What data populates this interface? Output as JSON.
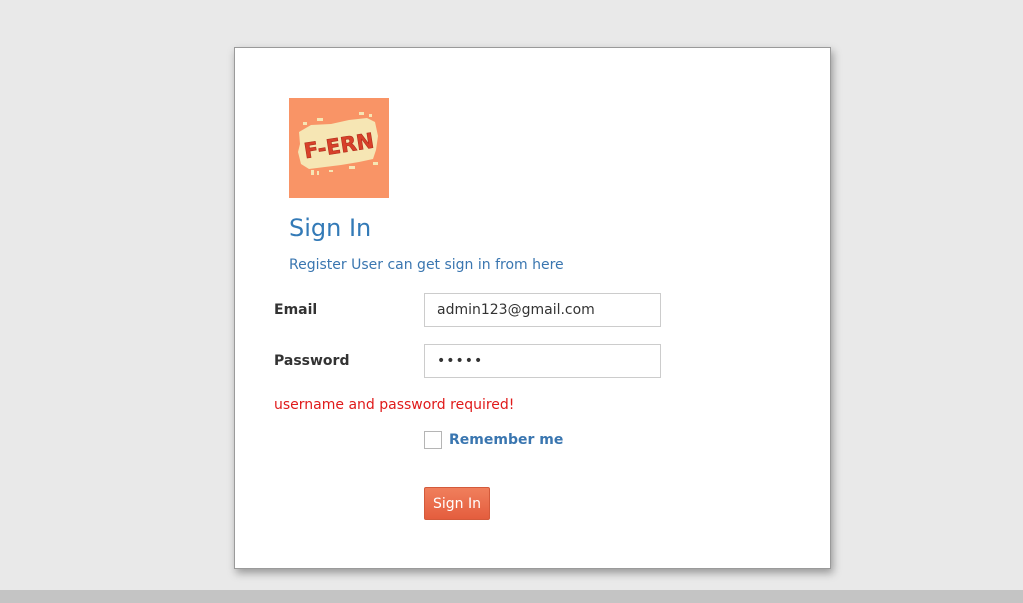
{
  "logo": {
    "text": "F-ERN",
    "background_color": "#f99466"
  },
  "header": {
    "title": "Sign In",
    "subtitle": "Register User can get sign in from here"
  },
  "form": {
    "email_label": "Email",
    "email_value": "admin123@gmail.com",
    "password_label": "Password",
    "password_value": "•••••",
    "error_message": "username and password required!",
    "remember_label": "Remember me",
    "remember_checked": false,
    "submit_label": "Sign In"
  },
  "colors": {
    "accent": "#337ab7",
    "error": "#e01a1a",
    "button": "#e8674a",
    "page_background": "#e9e9e9"
  }
}
